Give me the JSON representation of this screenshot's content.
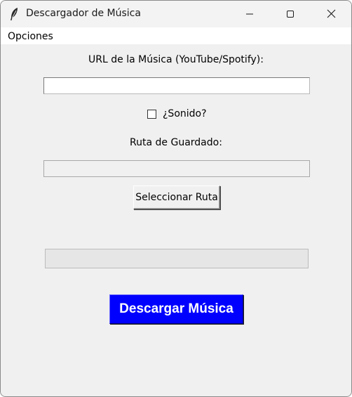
{
  "window": {
    "title": "Descargador de Música"
  },
  "menubar": {
    "items": [
      {
        "label": "Opciones"
      }
    ]
  },
  "form": {
    "url_label": "URL de la Música (YouTube/Spotify):",
    "url_value": "",
    "sound_checkbox_label": "¿Sonido?",
    "sound_checked": false,
    "path_label": "Ruta de Guardado:",
    "path_value": "",
    "select_path_button": "Seleccionar Ruta",
    "progress_fraction": 0,
    "download_button": "Descargar Música"
  },
  "colors": {
    "download_button_bg": "#0000ff",
    "download_button_text": "#ffffff",
    "window_bg": "#f0f0f0"
  },
  "icons": {
    "app": "feather-icon",
    "minimize": "minimize-icon",
    "maximize": "maximize-icon",
    "close": "close-icon"
  }
}
